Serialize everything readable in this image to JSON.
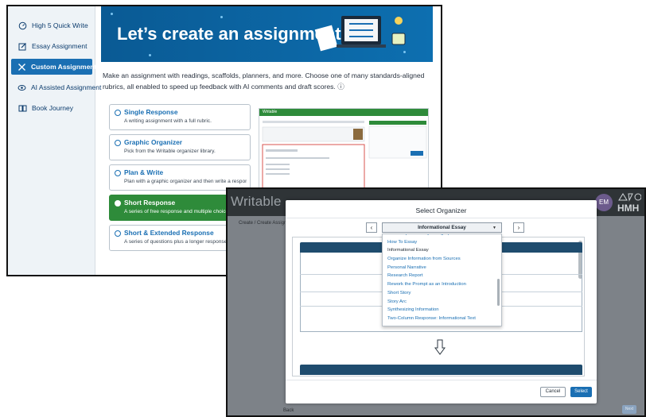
{
  "back": {
    "sidebar": [
      {
        "label": "High 5 Quick Write",
        "icon": "gauge-icon"
      },
      {
        "label": "Essay Assignment",
        "icon": "pencil-square-icon"
      },
      {
        "label": "Custom Assignment",
        "icon": "tools-icon",
        "active": true
      },
      {
        "label": "AI Assisted Assignment",
        "icon": "ai-sparkle-icon"
      },
      {
        "label": "Book Journey",
        "icon": "book-icon"
      }
    ],
    "banner_title": "Let’s create an assignment!",
    "intro": "Make an assignment with readings, scaffolds, planners, and more. Choose one of many standards-aligned rubrics, all enabled to speed up feedback with AI comments and draft scores. ⓘ",
    "options": [
      {
        "title": "Single Response",
        "desc": "A writing assignment with a full rubric."
      },
      {
        "title": "Graphic Organizer",
        "desc": "Pick from the Writable organizer library."
      },
      {
        "title": "Plan & Write",
        "desc": "Plan with a graphic organizer and then write a response."
      },
      {
        "title": "Short Response",
        "desc": "A series of free response and multiple choice q",
        "selected": true
      },
      {
        "title": "Short & Extended Response",
        "desc": "A series of questions plus a longer response."
      }
    ],
    "preview_brand": "Writable"
  },
  "front": {
    "brand": "Writable",
    "breadcrumb": "Create / Create Assign",
    "avatar": "EM",
    "logo": "HMH",
    "back_label": "Back",
    "next_label": "Next",
    "modal": {
      "title": "Select Organizer",
      "selected": "Informational Essay",
      "prev": "‹",
      "next": "›",
      "items": [
        "Four-Step Summary Paragraph",
        "How To Essay",
        "Informational Essay",
        "Organize Information from Sources",
        "Personal Narrative",
        "Research Report",
        "Rework the Prompt as an Introduction",
        "Short Story",
        "Story Arc",
        "Synthesizing Information",
        "Two-Column Response: Informational Text"
      ],
      "current_item": "Informational Essay",
      "cancel_label": "Cancel",
      "select_label": "Select"
    }
  }
}
